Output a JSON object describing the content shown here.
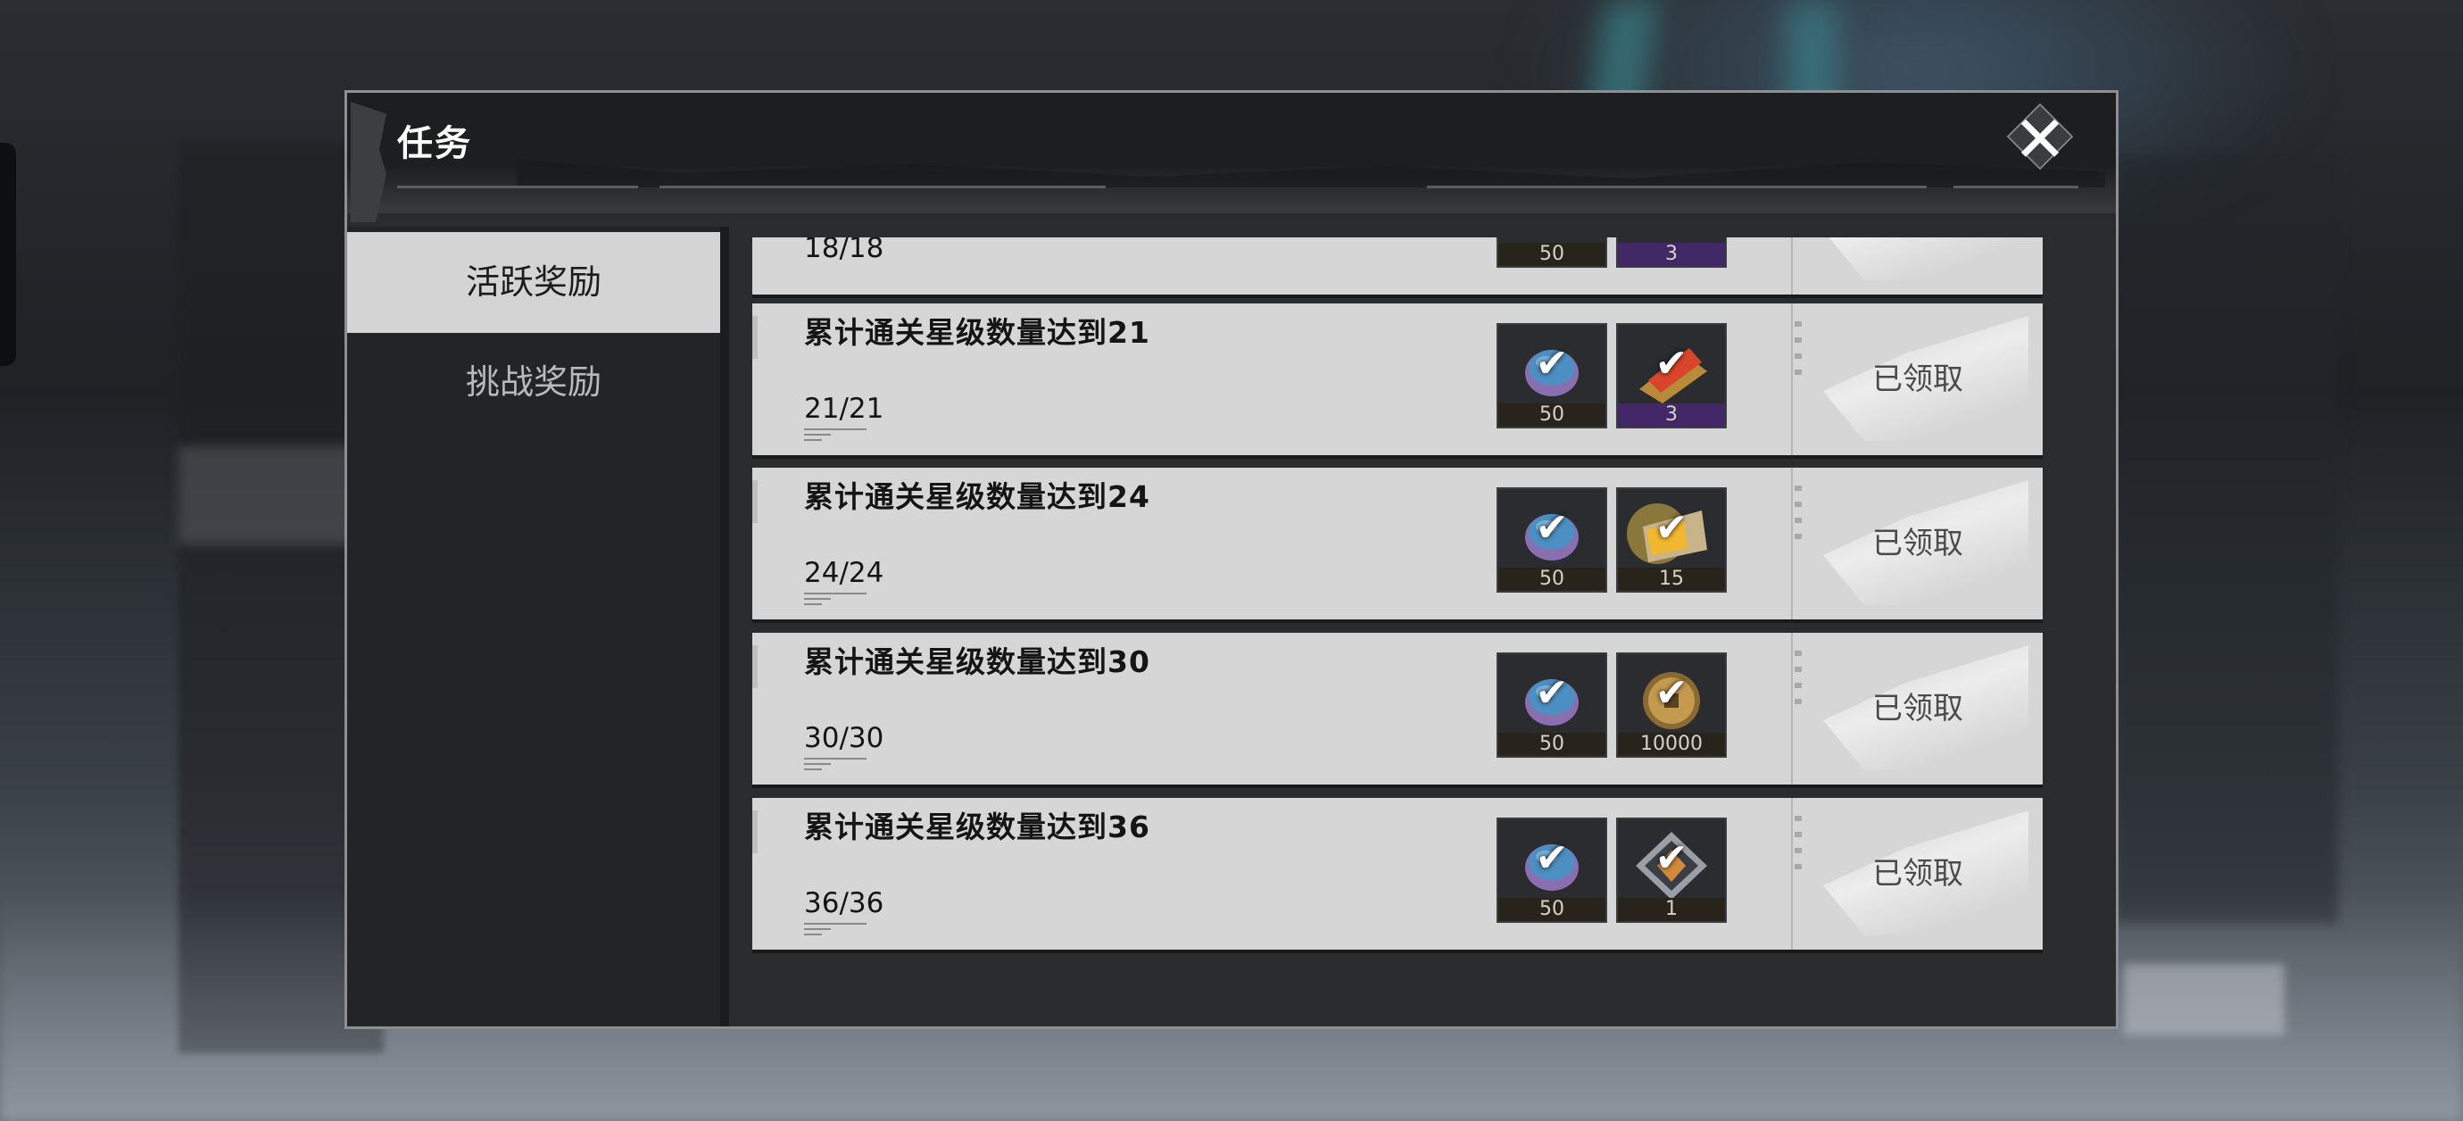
{
  "dialog": {
    "title": "任务",
    "close_label": "✕"
  },
  "tabs": [
    {
      "label": "活跃奖励",
      "active": true
    },
    {
      "label": "挑战奖励",
      "active": false
    }
  ],
  "tasks": [
    {
      "title": "",
      "progress": "18/18",
      "rewards": [
        {
          "icon": "coin-blue-icon",
          "count": "50"
        },
        {
          "icon": "purple-item-icon",
          "count": "3"
        }
      ],
      "status": ""
    },
    {
      "title": "累计通关星级数量达到21",
      "progress": "21/21",
      "rewards": [
        {
          "icon": "crystal-coin-icon",
          "count": "50"
        },
        {
          "icon": "fire-ingot-icon",
          "count": "3"
        }
      ],
      "status": "已领取"
    },
    {
      "title": "累计通关星级数量达到24",
      "progress": "24/24",
      "rewards": [
        {
          "icon": "crystal-coin-icon",
          "count": "50"
        },
        {
          "icon": "golden-ticket-icon",
          "count": "15"
        }
      ],
      "status": "已领取"
    },
    {
      "title": "累计通关星级数量达到30",
      "progress": "30/30",
      "rewards": [
        {
          "icon": "crystal-coin-icon",
          "count": "50"
        },
        {
          "icon": "gold-coin-icon",
          "count": "10000"
        }
      ],
      "status": "已领取"
    },
    {
      "title": "累计通关星级数量达到36",
      "progress": "36/36",
      "rewards": [
        {
          "icon": "crystal-coin-icon",
          "count": "50"
        },
        {
          "icon": "diamond-badge-icon",
          "count": "1"
        }
      ],
      "status": "已领取"
    }
  ],
  "claimed_check": "✔",
  "colors": {
    "card_bg": "#d6d6d6",
    "dialog_bg": "#2b2c2e",
    "active_tab": "#d4d4d4"
  }
}
